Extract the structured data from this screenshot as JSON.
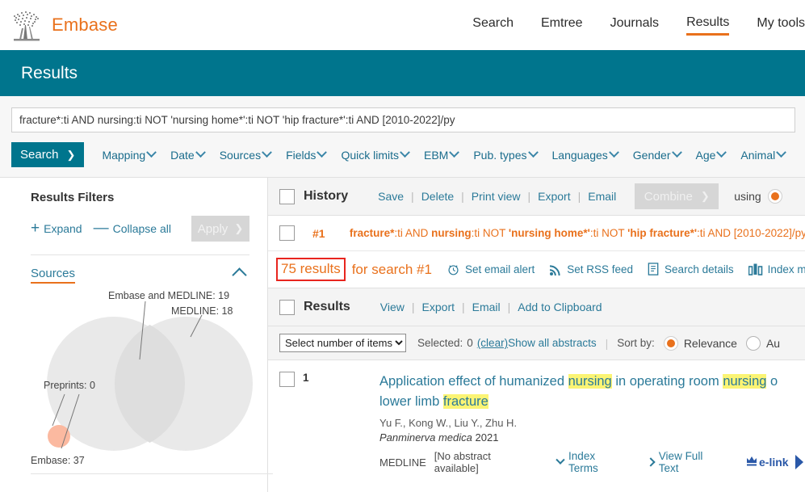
{
  "header": {
    "brand": "Embase",
    "logo_icon": "embase-tree-logo",
    "nav": [
      {
        "label": "Search",
        "active": false
      },
      {
        "label": "Emtree",
        "active": false
      },
      {
        "label": "Journals",
        "active": false
      },
      {
        "label": "Results",
        "active": true
      },
      {
        "label": "My tools",
        "active": false
      }
    ]
  },
  "banner": {
    "title": "Results"
  },
  "search": {
    "query_value": "fracture*:ti AND nursing:ti NOT 'nursing home*':ti NOT 'hip fracture*':ti AND [2010-2022]/py",
    "search_button": "Search",
    "facets": [
      "Mapping",
      "Date",
      "Sources",
      "Fields",
      "Quick limits",
      "EBM",
      "Pub. types",
      "Languages",
      "Gender",
      "Age",
      "Animal"
    ]
  },
  "sidebar": {
    "title": "Results Filters",
    "expand_label": "Expand",
    "collapse_label": "Collapse all",
    "apply_label": "Apply",
    "apply_disabled": true,
    "sources_label": "Sources",
    "venn": {
      "embase_medline": "Embase and MEDLINE: 19",
      "medline": "MEDLINE: 18",
      "preprints": "Preprints: 0",
      "embase": "Embase: 37"
    }
  },
  "history": {
    "title": "History",
    "links": [
      "Save",
      "Delete",
      "Print view",
      "Export",
      "Email"
    ],
    "combine_label": "Combine",
    "combine_disabled": true,
    "using_label": "using",
    "rows": [
      {
        "id": "#1",
        "query_parts": [
          {
            "text": "fracture*",
            "bold": true
          },
          {
            "text": ":ti AND ",
            "bold": false
          },
          {
            "text": "nursing",
            "bold": true
          },
          {
            "text": ":ti NOT ",
            "bold": false
          },
          {
            "text": "'nursing home*'",
            "bold": true
          },
          {
            "text": ":ti NOT ",
            "bold": false
          },
          {
            "text": "'hip fracture*'",
            "bold": true
          },
          {
            "text": ":ti AND [2010-2022]/py",
            "bold": false
          }
        ]
      }
    ]
  },
  "results_count": {
    "count_text": "75 results",
    "for_text": "for search #1",
    "highlighted": true,
    "highlight_color": "#e8251f",
    "tools": [
      {
        "label": "Set email alert",
        "icon": "alarm-clock-icon"
      },
      {
        "label": "Set RSS feed",
        "icon": "rss-icon"
      },
      {
        "label": "Search details",
        "icon": "document-icon"
      },
      {
        "label": "Index m",
        "icon": "bar-chart-icon"
      }
    ]
  },
  "results_bar": {
    "title": "Results",
    "links": [
      "View",
      "Export",
      "Email",
      "Add to Clipboard"
    ]
  },
  "options": {
    "number_select": "Select number of items",
    "selected_label": "Selected:",
    "selected_count": "0",
    "clear_label": "(clear)",
    "show_abstracts_label": "Show all abstracts",
    "sort_label": "Sort by:",
    "sort_options": [
      {
        "label": "Relevance",
        "selected": true
      },
      {
        "label": "Au",
        "selected": false
      }
    ]
  },
  "results": [
    {
      "number": "1",
      "title_line1": [
        {
          "text": "Application effect of humanized ",
          "hl": false
        },
        {
          "text": "nursing",
          "hl": true
        },
        {
          "text": " in operating room ",
          "hl": false
        },
        {
          "text": "nursing",
          "hl": true
        },
        {
          "text": " o",
          "hl": false
        }
      ],
      "title_line2": [
        {
          "text": "lower limb ",
          "hl": false
        },
        {
          "text": "fracture",
          "hl": true
        }
      ],
      "authors": "Yu F., Kong W., Liu Y., Zhu H.",
      "journal_name": "Panminerva medica",
      "journal_year": "2021",
      "source": "MEDLINE",
      "abstract_note": "[No abstract available]",
      "index_terms_label": "Index Terms",
      "full_text_label": "View Full Text",
      "elink_label": "e-link"
    }
  ],
  "colors": {
    "brand_orange": "#e9711c",
    "teal": "#00758d",
    "link_blue": "#2b7a99",
    "highlight_yellow": "#fbf474",
    "annotation_red": "#e8251f"
  }
}
